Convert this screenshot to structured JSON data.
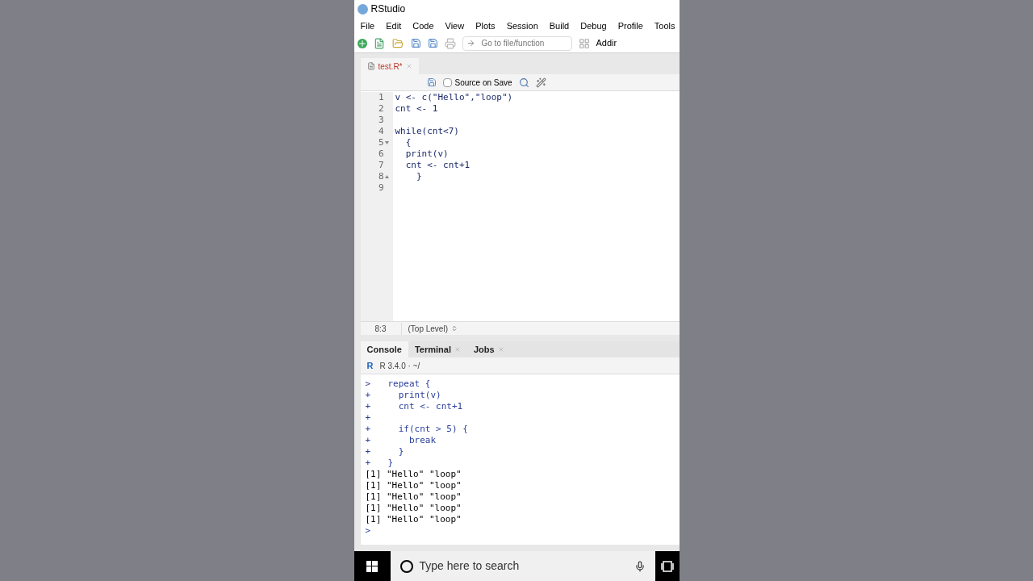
{
  "window": {
    "title": "RStudio"
  },
  "menu": [
    "File",
    "Edit",
    "Code",
    "View",
    "Plots",
    "Session",
    "Build",
    "Debug",
    "Profile",
    "Tools"
  ],
  "toolbar": {
    "goto_placeholder": "Go to file/function",
    "addins": "Addir"
  },
  "editor": {
    "tabs": [
      {
        "label": "test.R*",
        "selected": true,
        "modified": true
      }
    ],
    "source_on_save": {
      "label": "Source on Save",
      "checked": false
    },
    "lines": [
      {
        "number": "1",
        "code": "v <- c(\"Hello\",\"loop\")"
      },
      {
        "number": "2",
        "code": "cnt <- 1"
      },
      {
        "number": "3"
      },
      {
        "number": "4",
        "code": "while(cnt<7)"
      },
      {
        "number": "5",
        "code": "  {",
        "fold_start": true
      },
      {
        "number": "6",
        "code": "  print(v)"
      },
      {
        "number": "7",
        "code": "  cnt <- cnt+1"
      },
      {
        "number": "8",
        "code": "    }",
        "fold_end": true
      },
      {
        "number": "9"
      }
    ],
    "status": {
      "position": "8:3",
      "scope": "(Top Level)"
    }
  },
  "console": {
    "tabs": [
      {
        "label": "Console",
        "selected": true,
        "closable": false
      },
      {
        "label": "Terminal",
        "selected": false,
        "closable": true
      },
      {
        "label": "Jobs",
        "selected": false,
        "closable": true
      }
    ],
    "logo": "R",
    "version": "R 3.4.0 · ~/",
    "lines": [
      {
        "kind": "input",
        "prompt": ">",
        "text": "repeat {"
      },
      {
        "kind": "input",
        "prompt": "+",
        "text": "  print(v)"
      },
      {
        "kind": "input",
        "prompt": "+",
        "text": "  cnt <- cnt+1"
      },
      {
        "kind": "input",
        "prompt": "+"
      },
      {
        "kind": "input",
        "prompt": "+",
        "text": "  if(cnt > 5) {"
      },
      {
        "kind": "input",
        "prompt": "+",
        "text": "    break"
      },
      {
        "kind": "input",
        "prompt": "+",
        "text": "  }"
      },
      {
        "kind": "input",
        "prompt": "+",
        "text": "}"
      },
      {
        "kind": "output",
        "text": "[1] \"Hello\" \"loop\""
      },
      {
        "kind": "output",
        "text": "[1] \"Hello\" \"loop\""
      },
      {
        "kind": "output",
        "text": "[1] \"Hello\" \"loop\""
      },
      {
        "kind": "output",
        "text": "[1] \"Hello\" \"loop\""
      },
      {
        "kind": "output",
        "text": "[1] \"Hello\" \"loop\""
      },
      {
        "kind": "input",
        "prompt": ">"
      }
    ]
  },
  "taskbar": {
    "search_placeholder": "Type here to search"
  }
}
